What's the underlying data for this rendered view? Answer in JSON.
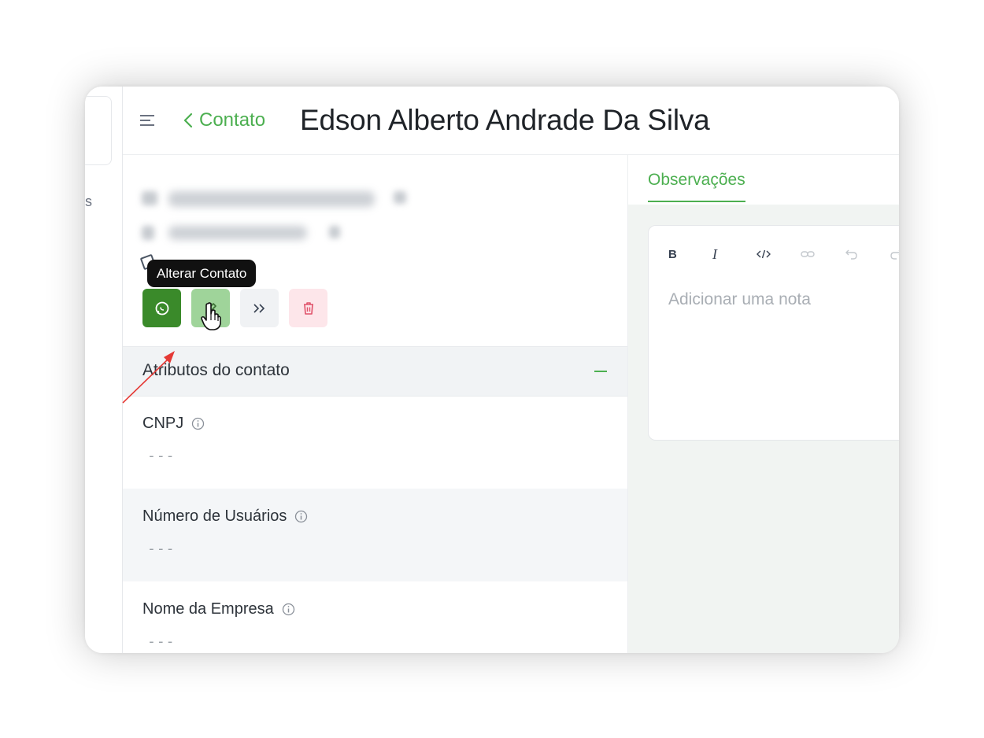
{
  "header": {
    "back_label": "Contato",
    "title": "Edson Alberto Andrade Da Silva"
  },
  "sidebar": {
    "fragment": "s"
  },
  "actions": {
    "tooltip": "Alterar Contato"
  },
  "attributes": {
    "section_title": "Atributos do contato",
    "items": [
      {
        "label": "CNPJ",
        "value": "---"
      },
      {
        "label": "Número de Usuários",
        "value": "---"
      },
      {
        "label": "Nome da Empresa",
        "value": "---"
      }
    ]
  },
  "notes": {
    "tab_label": "Observações",
    "placeholder": "Adicionar uma nota",
    "toolbar": {
      "bold": "B",
      "italic": "I"
    }
  },
  "colors": {
    "brand_green": "#4caf50",
    "whatsapp_button": "#3a8a2a",
    "edit_button": "#9fd49a",
    "delete_button_bg": "#fde6ea",
    "annotation_arrow": "#e53935"
  }
}
